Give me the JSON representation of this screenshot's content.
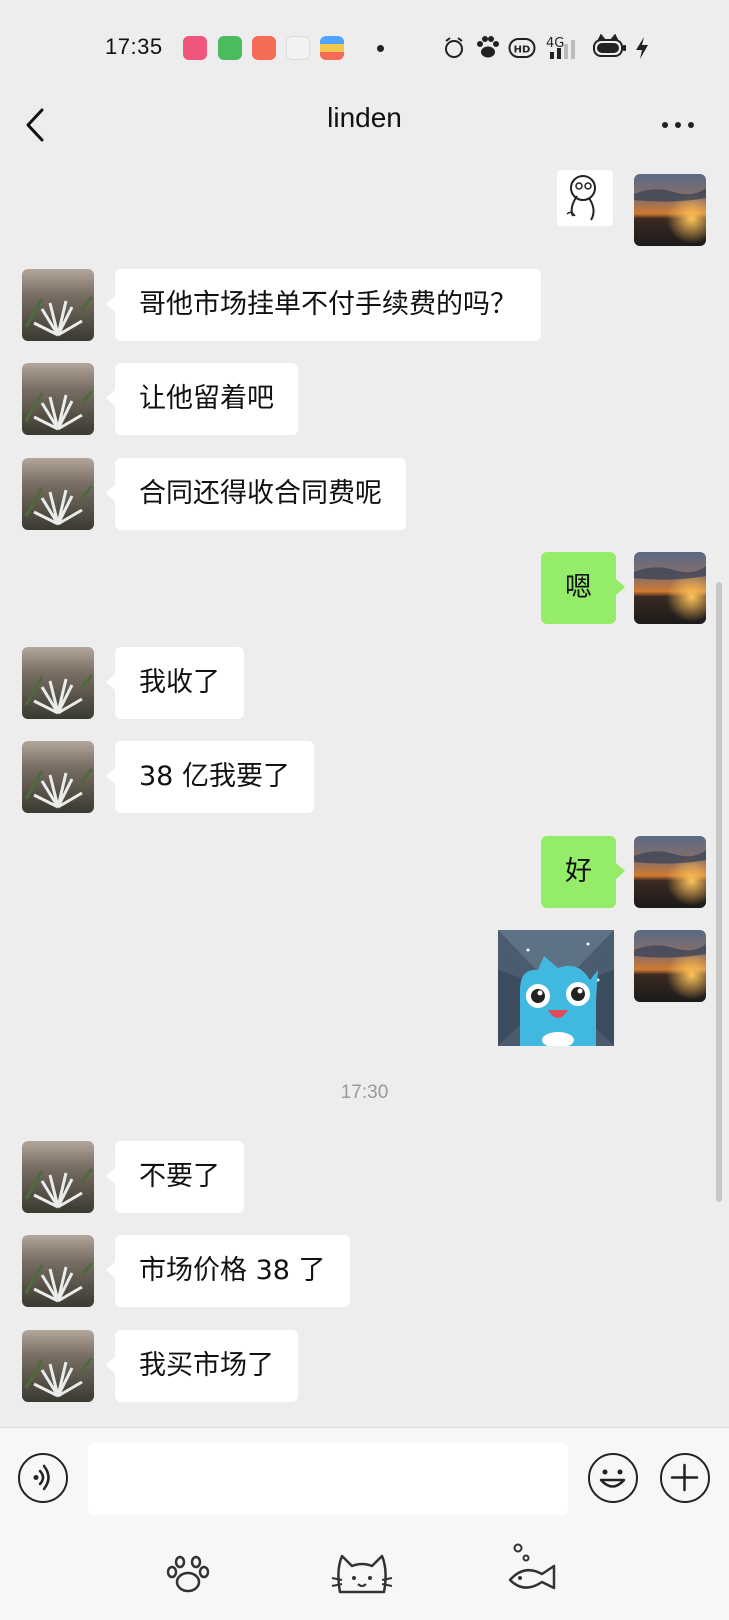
{
  "status_bar": {
    "time": "17:35",
    "notif_colors": [
      "#f0567b",
      "#4cbb5d",
      "#f56b57",
      "#f2f2f2",
      "#f2c94c"
    ],
    "network": "4G"
  },
  "nav": {
    "title": "linden"
  },
  "messages": [
    {
      "side": "right",
      "kind": "sticker",
      "sticker": "doodle-face"
    },
    {
      "side": "left",
      "kind": "text",
      "text": "哥他市场挂单不付手续费的吗？"
    },
    {
      "side": "left",
      "kind": "text",
      "text": "让他留着吧"
    },
    {
      "side": "left",
      "kind": "text",
      "text": "合同还得收合同费呢"
    },
    {
      "side": "right",
      "kind": "text",
      "text": "嗯"
    },
    {
      "side": "left",
      "kind": "text",
      "text": "我收了"
    },
    {
      "side": "left",
      "kind": "text",
      "text": "38 亿我要了"
    },
    {
      "side": "right",
      "kind": "text",
      "text": "好"
    },
    {
      "side": "right",
      "kind": "sticker",
      "sticker": "blue-cat"
    },
    {
      "kind": "time",
      "text": "17:30"
    },
    {
      "side": "left",
      "kind": "text",
      "text": "不要了"
    },
    {
      "side": "left",
      "kind": "text",
      "text": "市场价格 38 了"
    },
    {
      "side": "left",
      "kind": "text",
      "text": "我买市场了"
    }
  ],
  "input": {
    "placeholder": ""
  },
  "colors": {
    "background": "#ededed",
    "bubble_mine": "#95ec69",
    "bubble_theirs": "#ffffff"
  }
}
